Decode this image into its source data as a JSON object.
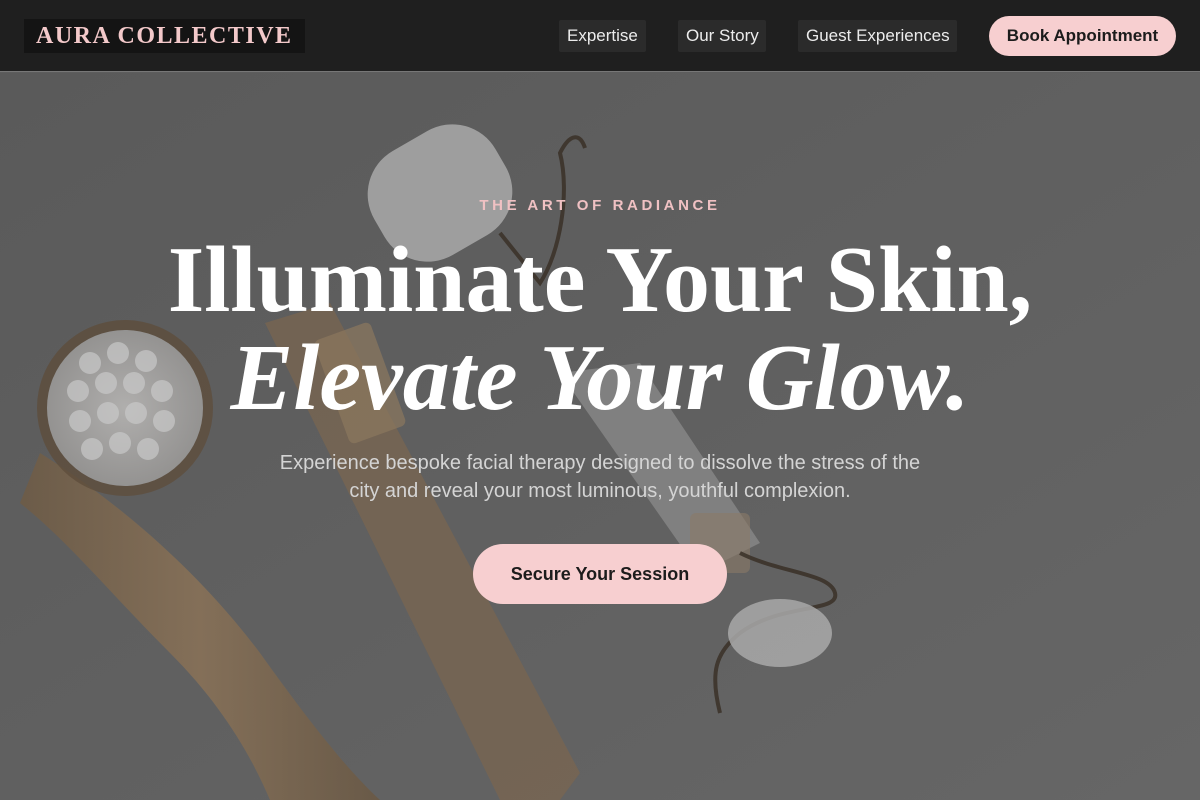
{
  "header": {
    "logo": "AURA COLLECTIVE",
    "nav": [
      {
        "label": "Expertise"
      },
      {
        "label": "Our Story"
      },
      {
        "label": "Guest Experiences"
      }
    ],
    "book_label": "Book Appointment"
  },
  "hero": {
    "eyebrow": "THE ART OF RADIANCE",
    "headline_line1": "Illuminate Your Skin,",
    "headline_line2": "Elevate Your Glow.",
    "subtext": "Experience bespoke facial therapy designed to dissolve the stress of the city and reveal your most luminous, youthful complexion.",
    "cta_label": "Secure Your Session",
    "background_image": "jade-roller-and-facial-brush-photo"
  },
  "colors": {
    "accent": "#f7cfd0",
    "eyebrow": "#f0c1c3",
    "header_bg": "#1f1f1f",
    "overlay": "#5d5d5d"
  }
}
